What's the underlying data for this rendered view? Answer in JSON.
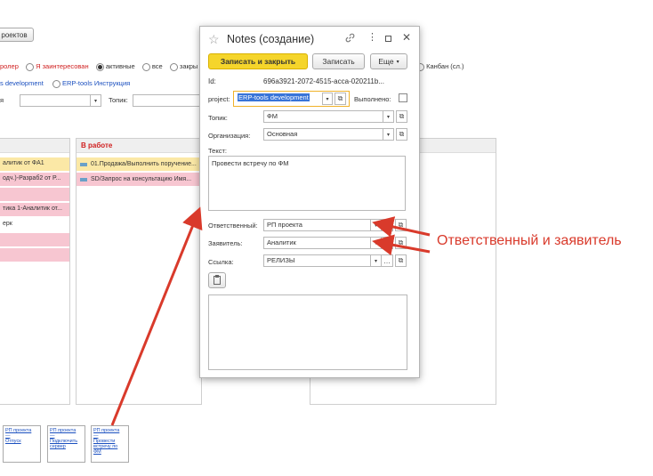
{
  "background": {
    "projects_button": "роектов",
    "filters": {
      "f1": "ролер",
      "f2": "Я заинтересован",
      "f3": "активные",
      "f4": "все",
      "f5": "закры",
      "kanban": "Канбан (сл.)"
    },
    "links": {
      "l1": "s development",
      "l2": "ERP-tools Инструкция"
    },
    "topic_label": "Топик:",
    "partial_label": "я",
    "column_in_progress": "В работе",
    "left_cards": [
      "алитик от ФА1",
      "одч.)-Разраб2 от Р...",
      "тика 1-Аналитик от...",
      "ерк",
      "",
      ""
    ],
    "progress_cards": [
      "01.Продажа/Выполнить поручение...",
      "SD/Запрос на консультацию Имя..."
    ],
    "thumb_cards": [
      {
        "line1": "РП проекта",
        "line2": "Отпуск"
      },
      {
        "line1": "РП проекта",
        "line2": "Подключить сервер"
      },
      {
        "line1": "РП проекта",
        "line2": "Провести встречу по ФМ"
      }
    ]
  },
  "dialog": {
    "title": "Notes (создание)",
    "buttons": {
      "save_close": "Записать и закрыть",
      "save": "Записать",
      "more": "Еще"
    },
    "id_label": "Id:",
    "id_value": "696a3921-2072-4515-acca-020211b...",
    "project_label": "project:",
    "project_value": "ERP-tools development",
    "done_label": "Выполнено:",
    "topic_label": "Топик:",
    "topic_value": "ФМ",
    "org_label": "Организация:",
    "org_value": "Основная",
    "text_label": "Текст:",
    "text_value": "Провести встречу по ФМ",
    "resp_label": "Ответственный:",
    "resp_value": "РП проекта",
    "applicant_label": "Заявитель:",
    "applicant_value": "Аналитик",
    "link_label": "Ссылка:",
    "link_value": "РЕЛИЗЫ"
  },
  "annotation": {
    "text": "Ответственный и заявитель",
    "color": "#d93a2b"
  },
  "colors": {
    "accent_yellow": "#f5d52b",
    "card_yellow": "#fbe8a6",
    "card_pink": "#f7c6d1"
  }
}
